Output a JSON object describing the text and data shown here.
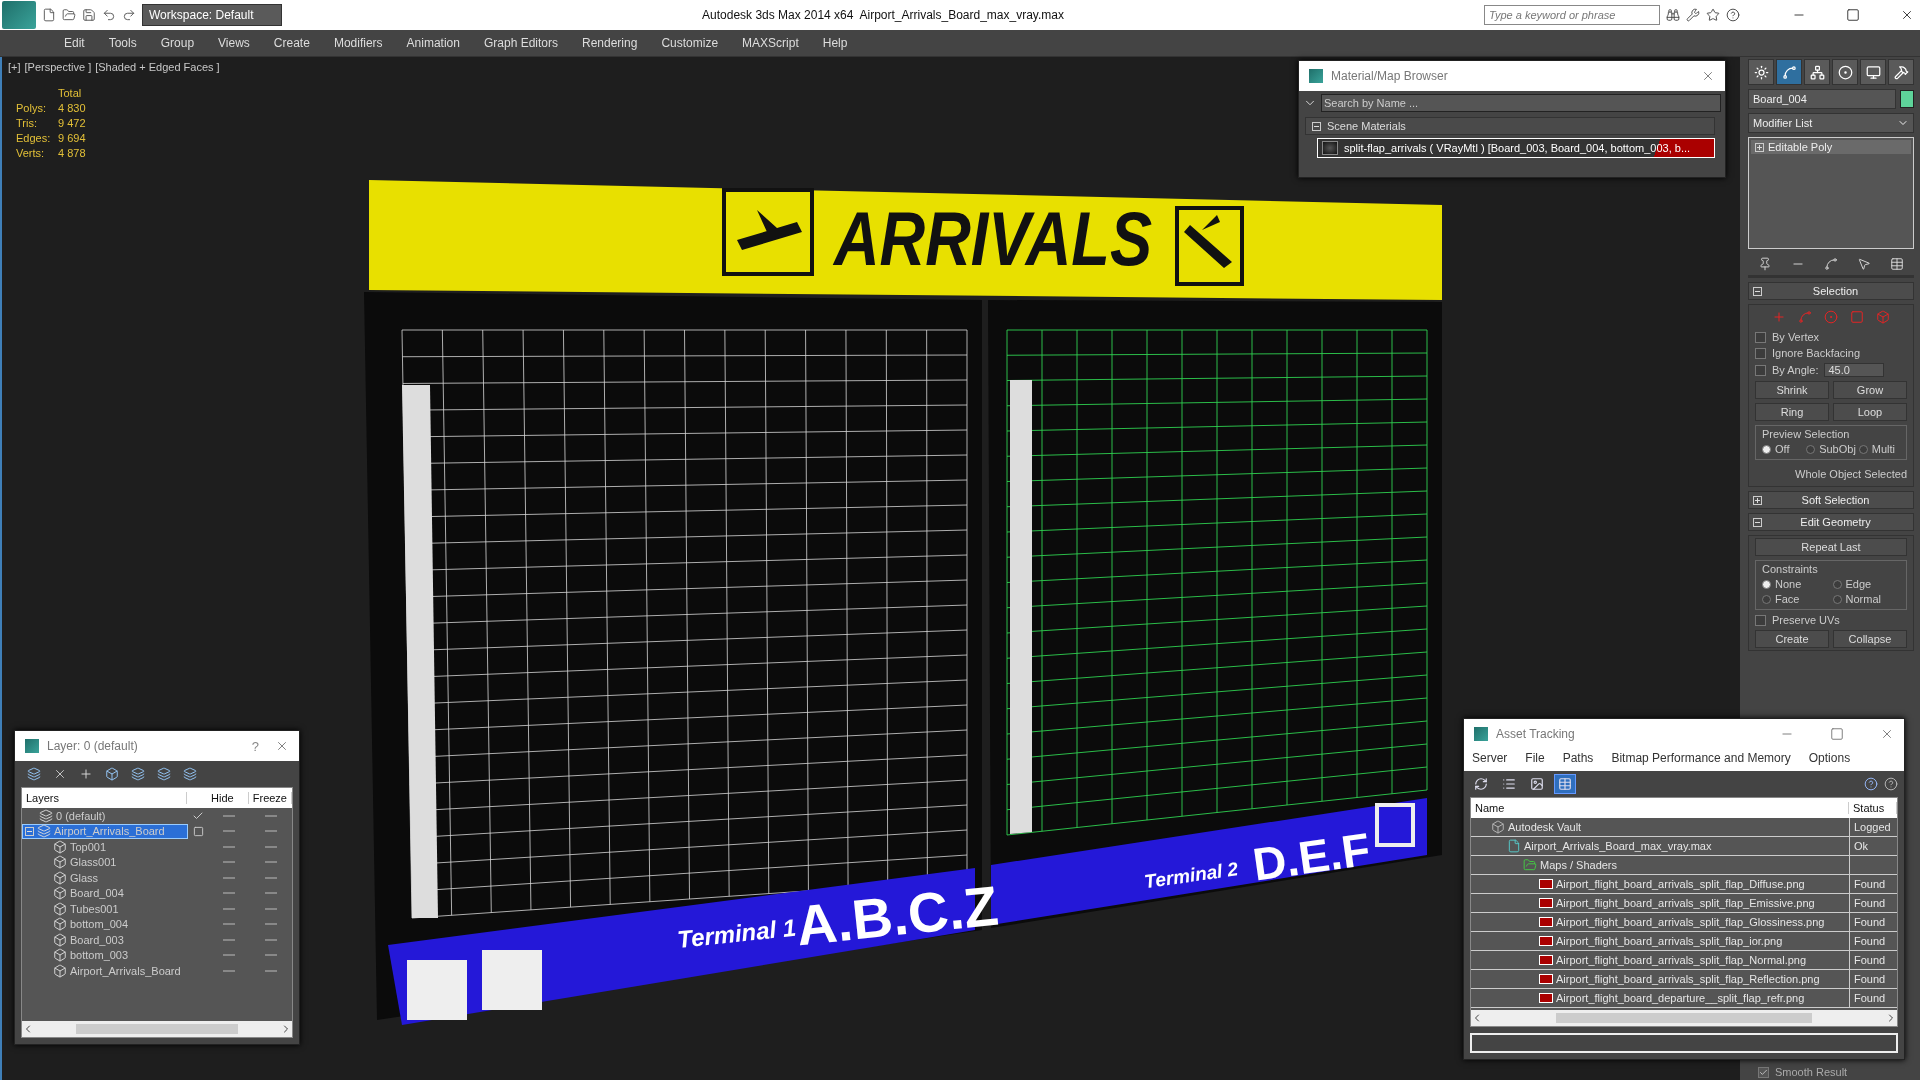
{
  "title_bar": {
    "workspace": "Workspace: Default",
    "app_title": "Autodesk 3ds Max  2014 x64",
    "file_name": "Airport_Arrivals_Board_max_vray.max",
    "search": {
      "placeholder": "Type a keyword or phrase"
    }
  },
  "menu": [
    "Edit",
    "Tools",
    "Group",
    "Views",
    "Create",
    "Modifiers",
    "Animation",
    "Graph Editors",
    "Rendering",
    "Customize",
    "MAXScript",
    "Help"
  ],
  "viewport": {
    "labels": [
      "[+]",
      "[Perspective ]",
      "[Shaded + Edged Faces ]"
    ],
    "stats": {
      "heading": "Total",
      "rows": [
        {
          "label": "Polys:",
          "value": "4 830"
        },
        {
          "label": "Tris:",
          "value": "9 472"
        },
        {
          "label": "Edges:",
          "value": "9 694"
        },
        {
          "label": "Verts:",
          "value": "4 878"
        }
      ]
    },
    "board": {
      "title": "ARRIVALS",
      "left_terminal": "Terminal 1",
      "left_gates": "A.B.C.Z",
      "right_terminal": "Terminal 2",
      "right_gates": "D.E.F"
    }
  },
  "material_browser": {
    "title": "Material/Map Browser",
    "search": {
      "placeholder": "Search by Name ..."
    },
    "group": {
      "label": "Scene Materials",
      "expanded": true
    },
    "items": [
      {
        "label": "split-flap_arrivals  ( VRayMtl ) [Board_003, Board_004, bottom_003, b...",
        "selected": true
      }
    ]
  },
  "command_panel": {
    "tabs": [
      {
        "kind": "create",
        "selected": false
      },
      {
        "kind": "modify",
        "selected": true
      },
      {
        "kind": "hierarchy",
        "selected": false
      },
      {
        "kind": "motion",
        "selected": false
      },
      {
        "kind": "display",
        "selected": false
      },
      {
        "kind": "utilities",
        "selected": false
      }
    ],
    "object_name": "Board_004",
    "modifier_list": "Modifier List",
    "stack": [
      {
        "label": "Editable Poly",
        "expanded": false
      }
    ],
    "rollouts": [
      {
        "title": "Selection",
        "expanded": true
      },
      {
        "title": "Soft Selection",
        "expanded": false
      },
      {
        "title": "Edit Geometry",
        "expanded": true
      }
    ],
    "selection": {
      "checkboxes": [
        {
          "label": "By Vertex",
          "checked": false
        },
        {
          "label": "Ignore Backfacing",
          "checked": false
        },
        {
          "label": "By Angle:",
          "checked": false,
          "value": "45.0"
        }
      ],
      "buttons": [
        "Shrink",
        "Grow",
        "Ring",
        "Loop"
      ],
      "preview": {
        "label": "Preview Selection",
        "options": [
          {
            "label": "Off",
            "selected": true
          },
          {
            "label": "SubObj",
            "selected": false
          },
          {
            "label": "Multi",
            "selected": false
          }
        ]
      },
      "status": "Whole Object Selected"
    },
    "edit_geometry": {
      "repeat": "Repeat Last",
      "constraints": {
        "label": "Constraints",
        "options": [
          {
            "label": "None",
            "selected": true
          },
          {
            "label": "Edge",
            "selected": false
          },
          {
            "label": "Face",
            "selected": false
          },
          {
            "label": "Normal",
            "selected": false
          }
        ]
      },
      "preserve_uvs": {
        "label": "Preserve UVs",
        "checked": false
      },
      "buttons": [
        "Create",
        "Collapse"
      ],
      "smooth_result": {
        "label": "Smooth Result",
        "checked": true
      }
    }
  },
  "layer_panel": {
    "title": "Layer: 0 (default)",
    "help": "?",
    "columns": [
      "Layers",
      "Hide",
      "Freeze"
    ],
    "layers": [
      {
        "name": "0 (default)",
        "active": true,
        "selected": false
      },
      {
        "name": "Airport_Arrivals_Board",
        "active": false,
        "selected": true,
        "expanded": true,
        "children": [
          "Top001",
          "Glass001",
          "Glass",
          "Board_004",
          "Tubes001",
          "bottom_004",
          "Board_003",
          "bottom_003",
          "Airport_Arrivals_Board"
        ]
      }
    ]
  },
  "asset_tracking": {
    "title": "Asset Tracking",
    "menu": [
      "Server",
      "File",
      "Paths",
      "Bitmap Performance and Memory",
      "Options"
    ],
    "view_buttons": [
      {
        "kind": "refresh",
        "selected": false
      },
      {
        "kind": "list",
        "selected": false
      },
      {
        "kind": "thumbnails",
        "selected": false
      },
      {
        "kind": "table",
        "selected": true
      }
    ],
    "columns": [
      "Name",
      "Status"
    ],
    "tree": [
      {
        "kind": "vault",
        "name": "Autodesk Vault",
        "status": "Logged",
        "children": [
          {
            "kind": "max",
            "name": "Airport_Arrivals_Board_max_vray.max",
            "status": "Ok",
            "children": [
              {
                "kind": "folder",
                "name": "Maps / Shaders",
                "children": [
                  {
                    "kind": "png",
                    "name": "Airport_flight_board_arrivals_split_flap_Diffuse.png",
                    "status": "Found"
                  },
                  {
                    "kind": "png",
                    "name": "Airport_flight_board_arrivals_split_flap_Emissive.png",
                    "status": "Found"
                  },
                  {
                    "kind": "png",
                    "name": "Airport_flight_board_arrivals_split_flap_Glossiness.png",
                    "status": "Found"
                  },
                  {
                    "kind": "png",
                    "name": "Airport_flight_board_arrivals_split_flap_ior.png",
                    "status": "Found"
                  },
                  {
                    "kind": "png",
                    "name": "Airport_flight_board_arrivals_split_flap_Normal.png",
                    "status": "Found"
                  },
                  {
                    "kind": "png",
                    "name": "Airport_flight_board_arrivals_split_flap_Reflection.png",
                    "status": "Found"
                  },
                  {
                    "kind": "png",
                    "name": "Airport_flight_board_departure__split_flap_refr.png",
                    "status": "Found"
                  }
                ]
              }
            ]
          }
        ]
      }
    ]
  }
}
